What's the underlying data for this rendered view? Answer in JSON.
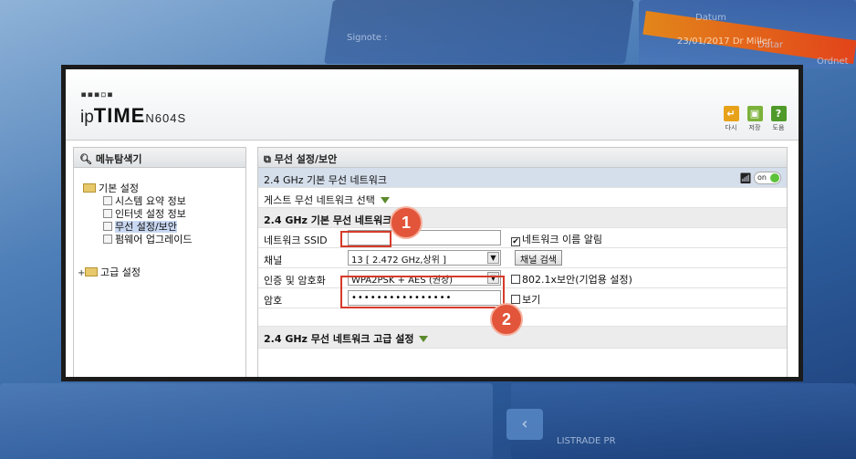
{
  "background": {
    "texts": [
      "Signote :",
      "Datum",
      "Datar",
      "Ordnet",
      "23/01/2017  Dr Miller",
      "LISTRADE PR"
    ]
  },
  "header": {
    "logo_dots": "▪▪▪▫▪",
    "logo_ip": "ip",
    "logo_time": "TIME",
    "model": "N604S",
    "icons": [
      {
        "name": "reset-icon",
        "label": "다시",
        "color": "#e8a21a"
      },
      {
        "name": "save-icon",
        "label": "저장",
        "color": "#7bb23a"
      },
      {
        "name": "help-icon",
        "label": "도움",
        "color": "#4f9a2a"
      }
    ]
  },
  "sidebar": {
    "title": "메뉴탐색기",
    "group1": "기본 설정",
    "items": [
      {
        "label": "시스템 요약 정보"
      },
      {
        "label": "인터넷 설정 정보"
      },
      {
        "label": "무선 설정/보안"
      },
      {
        "label": "펌웨어 업그레이드"
      }
    ],
    "group2": "고급 설정"
  },
  "main": {
    "title": "무선 설정/보안",
    "band_row": "2.4 GHz 기본 무선 네트워크",
    "toggle_label": "on",
    "guest_row": "게스트 무선 네트워크 선택",
    "basic_section": "2.4 GHz 기본 무선 네트워크",
    "ssid_label": "네트워크 SSID",
    "ssid_value": "",
    "broadcast_label": "네트워크 이름 알림",
    "channel_label": "채널",
    "channel_value": "13 [ 2.472 GHz,상위 ]",
    "channel_scan": "채널 검색",
    "auth_label": "인증 및 암호화",
    "auth_value": "WPA2PSK + AES (권장)",
    "enterprise_label": "802.1x보안(기업용 설정)",
    "password_label": "암호",
    "password_value": "••••••••••••••••",
    "show_label": "보기",
    "advanced_section": "2.4 GHz 무선 네트워크 고급 설정"
  },
  "markers": {
    "first": "1",
    "second": "2"
  },
  "colors": {
    "marker": "#e2553a",
    "band_row": "#d5deeb",
    "toggle_on": "#5cc23a"
  }
}
